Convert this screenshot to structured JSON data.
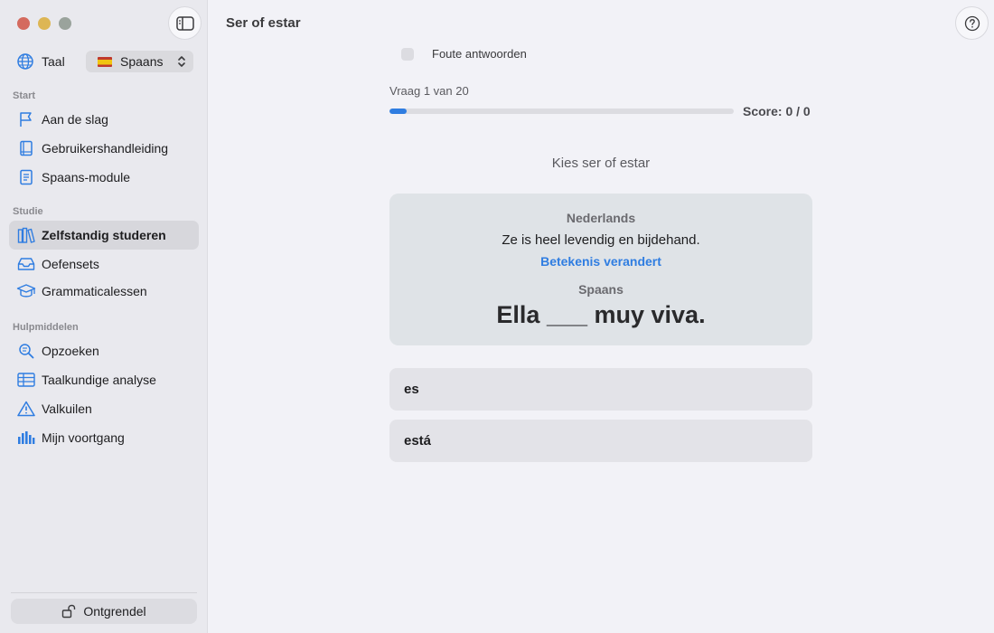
{
  "window": {
    "title": "Ser of estar"
  },
  "sidebar": {
    "language": {
      "label": "Taal",
      "selected": "Spaans"
    },
    "sections": [
      {
        "title": "Start",
        "items": [
          {
            "label": "Aan de slag",
            "icon": "flag-icon"
          },
          {
            "label": "Gebruikershandleiding",
            "icon": "book-icon"
          },
          {
            "label": "Spaans-module",
            "icon": "document-icon"
          }
        ]
      },
      {
        "title": "Studie",
        "items": [
          {
            "label": "Zelfstandig studeren",
            "icon": "books-icon",
            "active": true
          },
          {
            "label": "Oefensets",
            "icon": "tray-icon"
          },
          {
            "label": "Grammaticalessen",
            "icon": "graduation-cap-icon"
          }
        ]
      },
      {
        "title": "Hulpmiddelen",
        "items": [
          {
            "label": "Opzoeken",
            "icon": "search-icon"
          },
          {
            "label": "Taalkundige analyse",
            "icon": "table-icon"
          },
          {
            "label": "Valkuilen",
            "icon": "warning-icon"
          },
          {
            "label": "Mijn voortgang",
            "icon": "bar-chart-icon"
          }
        ]
      }
    ],
    "unlock_label": "Ontgrendel"
  },
  "quiz": {
    "wrong_answers_label": "Foute antwoorden",
    "question_count": "Vraag 1 van 20",
    "progress": 0.05,
    "score": "Score: 0 / 0",
    "prompt": "Kies ser of estar",
    "card": {
      "source_label": "Nederlands",
      "source_text": "Ze is heel levendig en bijdehand.",
      "meaning_link": "Betekenis verandert",
      "target_label": "Spaans",
      "target_text": "Ella ___ muy viva."
    },
    "answers": [
      "es",
      "está"
    ]
  },
  "colors": {
    "accent": "#2f7de1"
  }
}
